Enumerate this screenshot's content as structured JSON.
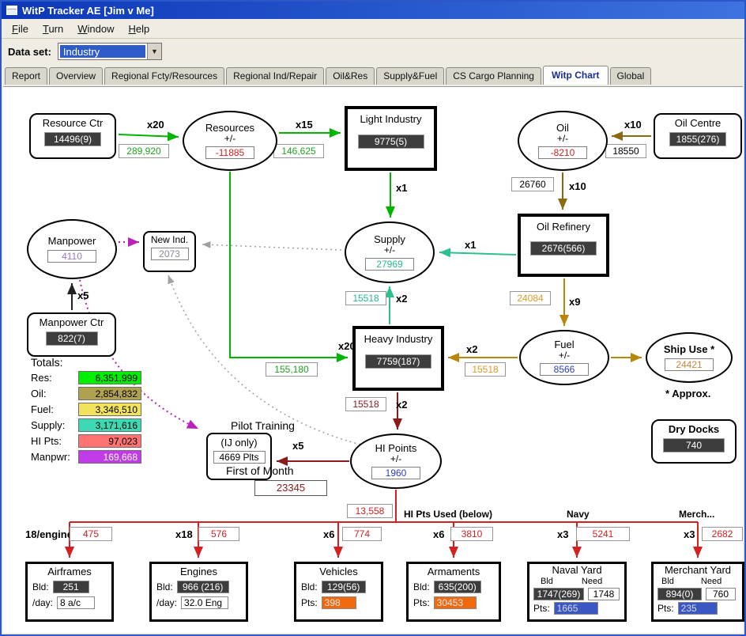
{
  "window": {
    "title": "WitP Tracker AE [Jim v Me]"
  },
  "menu": [
    {
      "m": "F",
      "rest": "ile"
    },
    {
      "m": "T",
      "rest": "urn"
    },
    {
      "m": "W",
      "rest": "indow"
    },
    {
      "m": "H",
      "rest": "elp"
    }
  ],
  "dataset": {
    "label": "Data set:",
    "value": "Industry"
  },
  "tabs": {
    "items": [
      "Report",
      "Overview",
      "Regional Fcty/Resources",
      "Regional Ind/Repair",
      "Oil&Res",
      "Supply&Fuel",
      "CS Cargo Planning",
      "Witp Chart",
      "Global"
    ],
    "selected": "Witp Chart"
  },
  "colors": {
    "flow_resources": "#00B400",
    "flow_supply": "#2FBF8F",
    "flow_oil": "#8B6914",
    "flow_fuel": "#B8860B",
    "flow_hi": "#8B1A1A",
    "flow_hi_used": "#D42020",
    "flow_manpower": "#BB20BB",
    "flow_misc": "#A0A0A0",
    "flow_black": "#222222"
  },
  "chart": {
    "nodes": {
      "resource_ctr": {
        "title": "Resource Ctr",
        "value": "14496(9)"
      },
      "resources": {
        "title": "Resources",
        "sub": "+/-",
        "value": "-11885"
      },
      "light_industry": {
        "title": "Light Industry",
        "value": "9775(5)"
      },
      "oil": {
        "title": "Oil",
        "sub": "+/-",
        "value": "-8210"
      },
      "oil_centre": {
        "title": "Oil Centre",
        "value": "1855(276)"
      },
      "manpower": {
        "title": "Manpower",
        "value": "4110"
      },
      "new_ind": {
        "title": "New Ind.",
        "value": "2073"
      },
      "supply": {
        "title": "Supply",
        "sub": "+/-",
        "value": "27969"
      },
      "oil_refinery": {
        "title": "Oil Refinery",
        "value": "2676(566)"
      },
      "manpower_ctr": {
        "title": "Manpower Ctr",
        "value": "822(7)"
      },
      "heavy_industry": {
        "title": "Heavy Industry",
        "value": "7759(187)"
      },
      "fuel": {
        "title": "Fuel",
        "sub": "+/-",
        "value": "8566"
      },
      "ship_use": {
        "title": "Ship Use *",
        "value": "24421",
        "note": "* Approx."
      },
      "pilot_training": {
        "label": "Pilot Training",
        "title": "(IJ only)",
        "value": "4669 Plts"
      },
      "hi_points": {
        "title": "HI Points",
        "sub": "+/-",
        "value": "1960"
      },
      "first_of_month": {
        "label": "First of Month",
        "value": "23345"
      },
      "dry_docks": {
        "title": "Dry Docks",
        "value": "740"
      }
    },
    "edges": {
      "res_ctr_to_resources": {
        "mult": "x20",
        "value": "289,920"
      },
      "resources_to_light": {
        "mult": "x15",
        "value": "146,625"
      },
      "oil_centre_to_oil": {
        "mult": "x10",
        "value": "18550"
      },
      "light_to_supply": {
        "mult": "x1"
      },
      "oil_to_refinery": {
        "mult": "x10",
        "value": "26760"
      },
      "refinery_to_supply": {
        "mult": "x1"
      },
      "heavy_to_supply": {
        "mult": "x2",
        "value": "15518"
      },
      "refinery_to_fuel": {
        "mult": "x9",
        "value": "24084"
      },
      "resources_to_heavy": {
        "mult": "x20",
        "value": "155,180"
      },
      "fuel_to_heavy": {
        "mult": "x2",
        "value": "15518"
      },
      "heavy_to_hipoints": {
        "mult": "x2",
        "value": "15518"
      },
      "hipoints_to_pilot": {
        "mult": "x5"
      },
      "manpower_ctr_to_manpower": {
        "mult": "x5"
      },
      "hi_pts_used": {
        "label": "HI Pts Used (below)",
        "value": "13,558"
      },
      "navy_label": "Navy",
      "merch_label": "Merch...",
      "to_airframes": {
        "mult": "18/engine",
        "value": "475"
      },
      "to_engines": {
        "mult": "x18",
        "value": "576"
      },
      "to_vehicles": {
        "mult": "x6",
        "value": "774"
      },
      "to_armaments": {
        "mult": "x6",
        "value": "3810"
      },
      "to_naval": {
        "mult": "x3",
        "value": "5241"
      },
      "to_merchant": {
        "mult": "x3",
        "value": "2682"
      }
    },
    "totals": {
      "title": "Totals:",
      "rows": [
        {
          "label": "Res:",
          "value": "6,351,999",
          "color": "#00EE00"
        },
        {
          "label": "Oil:",
          "value": "2,854,832",
          "color": "#B0A14E"
        },
        {
          "label": "Fuel:",
          "value": "3,346,510",
          "color": "#F2E25C"
        },
        {
          "label": "Supply:",
          "value": "3,171,616",
          "color": "#3CD9B4"
        },
        {
          "label": "HI Pts:",
          "value": "97,023",
          "color": "#FF7373"
        },
        {
          "label": "Manpwr:",
          "value": "169,668",
          "color": "#C23BE8"
        }
      ]
    },
    "factories": {
      "airframes": {
        "title": "Airframes",
        "r1_label": "Bld:",
        "r1_value": "251",
        "r2_label": "/day:",
        "r2_value": "8 a/c"
      },
      "engines": {
        "title": "Engines",
        "r1_label": "Bld:",
        "r1_value": "966 (216)",
        "r2_label": "/day:",
        "r2_value": "32.0 Eng"
      },
      "vehicles": {
        "title": "Vehicles",
        "r1_label": "Bld:",
        "r1_value": "129(56)",
        "r2_label": "Pts:",
        "r2_value": "398"
      },
      "armaments": {
        "title": "Armaments",
        "r1_label": "Bld:",
        "r1_value": "635(200)",
        "r2_label": "Pts:",
        "r2_value": "30453"
      },
      "naval_yard": {
        "title": "Naval Yard",
        "h1": "Bld",
        "h2": "Need",
        "bld": "1747(269)",
        "need": "1748",
        "pts_label": "Pts:",
        "pts": "1665"
      },
      "merchant_yard": {
        "title": "Merchant Yard",
        "h1": "Bld",
        "h2": "Need",
        "bld": "894(0)",
        "need": "760",
        "pts_label": "Pts:",
        "pts": "235"
      }
    }
  }
}
